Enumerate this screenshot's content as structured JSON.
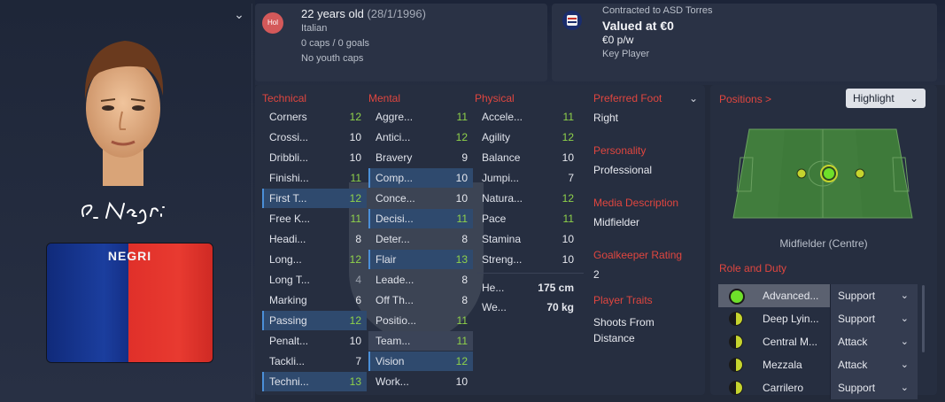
{
  "profile": {
    "age": "22 years old",
    "dob": "(28/1/1996)",
    "nationality": "Italian",
    "nation_badge": "Hol",
    "caps": "0 caps / 0 goals",
    "youth_caps": "No youth caps",
    "shirt_name": "NEGRI"
  },
  "contract": {
    "club_line": "Contracted to ASD Torres",
    "value": "Valued at €0",
    "wage": "€0 p/w",
    "status": "Key Player"
  },
  "technical": {
    "header": "Technical",
    "rows": [
      {
        "label": "Corners",
        "value": "12"
      },
      {
        "label": "Crossi...",
        "value": "10"
      },
      {
        "label": "Dribbli...",
        "value": "10"
      },
      {
        "label": "Finishi...",
        "value": "11"
      },
      {
        "label": "First T...",
        "value": "12"
      },
      {
        "label": "Free K...",
        "value": "11"
      },
      {
        "label": "Headi...",
        "value": "8"
      },
      {
        "label": "Long...",
        "value": "12"
      },
      {
        "label": "Long T...",
        "value": "4"
      },
      {
        "label": "Marking",
        "value": "6"
      },
      {
        "label": "Passing",
        "value": "12"
      },
      {
        "label": "Penalt...",
        "value": "10"
      },
      {
        "label": "Tackli...",
        "value": "7"
      },
      {
        "label": "Techni...",
        "value": "13"
      }
    ]
  },
  "mental": {
    "header": "Mental",
    "rows": [
      {
        "label": "Aggre...",
        "value": "11"
      },
      {
        "label": "Antici...",
        "value": "12"
      },
      {
        "label": "Bravery",
        "value": "9"
      },
      {
        "label": "Comp...",
        "value": "10"
      },
      {
        "label": "Conce...",
        "value": "10"
      },
      {
        "label": "Decisi...",
        "value": "11"
      },
      {
        "label": "Deter...",
        "value": "8"
      },
      {
        "label": "Flair",
        "value": "13"
      },
      {
        "label": "Leade...",
        "value": "8"
      },
      {
        "label": "Off Th...",
        "value": "8"
      },
      {
        "label": "Positio...",
        "value": "11"
      },
      {
        "label": "Team...",
        "value": "11"
      },
      {
        "label": "Vision",
        "value": "12"
      },
      {
        "label": "Work...",
        "value": "10"
      }
    ]
  },
  "physical": {
    "header": "Physical",
    "rows": [
      {
        "label": "Accele...",
        "value": "11"
      },
      {
        "label": "Agility",
        "value": "12"
      },
      {
        "label": "Balance",
        "value": "10"
      },
      {
        "label": "Jumpi...",
        "value": "7"
      },
      {
        "label": "Natura...",
        "value": "12"
      },
      {
        "label": "Pace",
        "value": "11"
      },
      {
        "label": "Stamina",
        "value": "10"
      },
      {
        "label": "Streng...",
        "value": "10"
      }
    ],
    "height_label": "He...",
    "height_value": "175 cm",
    "weight_label": "We...",
    "weight_value": "70 kg"
  },
  "details": {
    "foot_label": "Preferred Foot",
    "foot_value": "Right",
    "personality_label": "Personality",
    "personality_value": "Professional",
    "media_label": "Media Description",
    "media_value": "Midfielder",
    "gk_label": "Goalkeeper Rating",
    "gk_value": "2",
    "traits_label": "Player Traits",
    "traits_value_1": "Shoots From",
    "traits_value_2": "Distance"
  },
  "positions": {
    "title": "Positions >",
    "highlight": "Highlight",
    "caption": "Midfielder (Centre)",
    "role_duty_title": "Role and Duty",
    "roles": [
      {
        "name": "Advanced...",
        "duty": "Support"
      },
      {
        "name": "Deep Lyin...",
        "duty": "Support"
      },
      {
        "name": "Central M...",
        "duty": "Attack"
      },
      {
        "name": "Mezzala",
        "duty": "Attack"
      },
      {
        "name": "Carrilero",
        "duty": "Support"
      }
    ]
  },
  "colors": {
    "header_red": "#e0463f",
    "good_green": "#8fd24a",
    "shirt_blue": "#1b3e9e",
    "shirt_red": "#e83a30"
  },
  "icons": {
    "collapse": "chevron-down-icon",
    "club_crest": "torres-crest-icon",
    "nation": "nation-badge-icon"
  }
}
